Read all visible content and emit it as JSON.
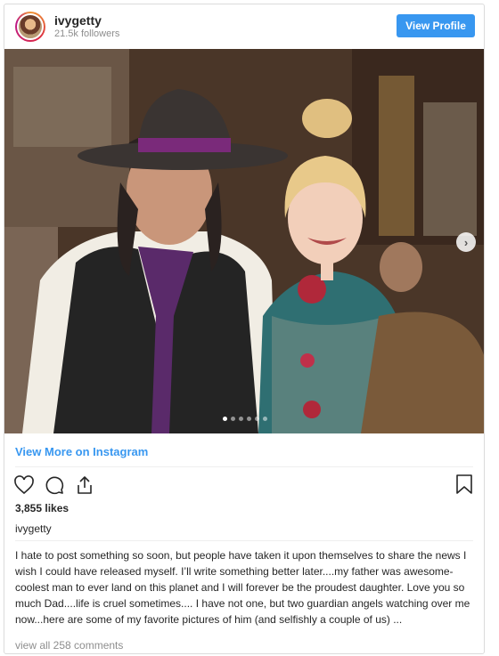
{
  "header": {
    "username": "ivygetty",
    "followers": "21.5k followers",
    "view_profile_label": "View Profile"
  },
  "media": {
    "description": "",
    "carousel_total": 6,
    "carousel_active_index": 0,
    "next_icon": "chevron-right-icon",
    "next_glyph": "›"
  },
  "links": {
    "view_more": "View More on Instagram"
  },
  "actions": {
    "icons": [
      "heart-icon",
      "comment-icon",
      "share-icon",
      "bookmark-icon"
    ]
  },
  "likes": "3,855 likes",
  "caption": {
    "username": "ivygetty",
    "text": "I hate to post something so soon, but people have taken it upon themselves to share the news I wish I could have released myself. I’ll write something better later....my father was awesome- coolest man to ever land on this planet and I will forever be the proudest daughter. Love you so much Dad....life is cruel sometimes.... I have not one, but two guardian angels watching over me now...here are some of my favorite pictures of him (and selfishly a couple of us) ..."
  },
  "comments_link": "view all 258 comments",
  "colors": {
    "accent": "#3897f0",
    "border": "#dbdbdb",
    "muted": "#8e8e8e",
    "text": "#262626"
  }
}
